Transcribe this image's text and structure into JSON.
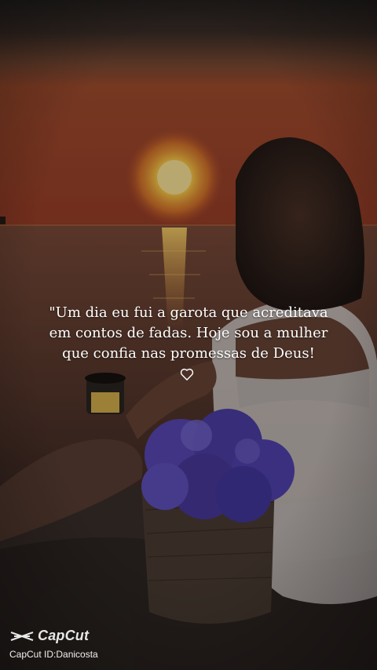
{
  "quote": {
    "lines": [
      "\"Um dia eu fui a garota que acreditava",
      "em contos de fadas. Hoje sou a mulher",
      "que confia nas promessas de Deus!"
    ],
    "symbol_icon": "heart-outline-icon"
  },
  "watermark": {
    "logo_icon": "capcut-logo-icon",
    "brand": "CapCut",
    "id_text": "CapCut ID:Danicosta"
  },
  "colors": {
    "sky_top": "#2a2522",
    "sun": "#ffcf4a",
    "sea": "#5b3a2e",
    "flowers": "#5a49b8"
  }
}
